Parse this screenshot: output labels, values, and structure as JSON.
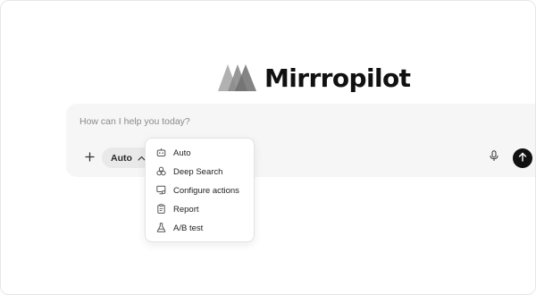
{
  "brand": {
    "name": "Mirrropilot",
    "logo_icon": "stacked-triangles-icon"
  },
  "composer": {
    "placeholder": "How can I help you today?",
    "add_icon": "plus-icon",
    "mode_label": "Auto",
    "mode_icon": "chevron-up-icon",
    "mic_icon": "microphone-icon",
    "send_icon": "arrow-up-icon"
  },
  "mode_menu": {
    "items": [
      {
        "label": "Auto",
        "icon": "robot-icon"
      },
      {
        "label": "Deep Search",
        "icon": "three-circles-icon"
      },
      {
        "label": "Configure actions",
        "icon": "monitor-gear-icon"
      },
      {
        "label": "Report",
        "icon": "clipboard-icon"
      },
      {
        "label": "A/B test",
        "icon": "flask-icon"
      }
    ]
  },
  "colors": {
    "accent": "#111111",
    "composer_bg": "#f6f6f6",
    "chip_bg": "#e9e9e9"
  }
}
